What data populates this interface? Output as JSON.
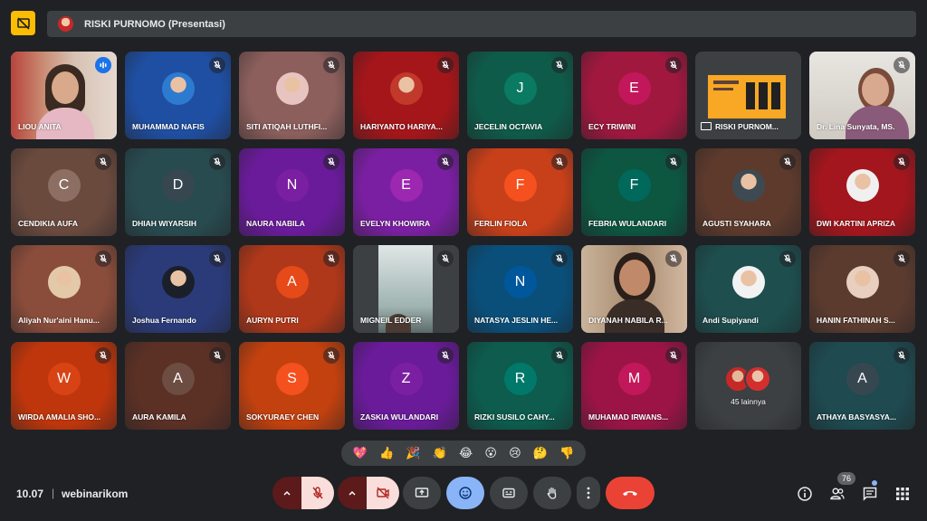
{
  "header": {
    "presenter_label": "RISKI PURNOMO (Presentasi)"
  },
  "tiles": [
    {
      "name": "LIOU ANITA",
      "kind": "video",
      "mic": "speaking",
      "bg": "#c8a58f"
    },
    {
      "name": "MUHAMMAD NAFIS",
      "kind": "photo",
      "mic": "muted",
      "bg": "#1f4fa3",
      "avatar": "#2d7bd1"
    },
    {
      "name": "SITI ATIQAH LUTHFI...",
      "kind": "photo",
      "mic": "muted",
      "bg": "#8c5f5c",
      "avatar": "#e8c4c0"
    },
    {
      "name": "HARIYANTO HARIYA...",
      "kind": "photo",
      "mic": "muted",
      "bg": "#a5161a",
      "avatar": "#c0392b"
    },
    {
      "name": "JECELIN OCTAVIA",
      "kind": "letter",
      "letter": "J",
      "mic": "muted",
      "bg": "#0f5b4a",
      "avatar": "#0b7a62"
    },
    {
      "name": "ECY TRIWINI",
      "kind": "letter",
      "letter": "E",
      "mic": "muted",
      "bg": "#a1183f",
      "avatar": "#c2185b"
    },
    {
      "name": "RISKI PURNOM...",
      "kind": "screen",
      "mic": "none",
      "bg": "#3c4043"
    },
    {
      "name": "Dr. Lina Sunyata, MS.",
      "kind": "video2",
      "mic": "muted",
      "bg": "#d9d6cf"
    },
    {
      "name": "CENDIKIA AUFA",
      "kind": "letter",
      "letter": "C",
      "mic": "muted",
      "bg": "#6b4a3e",
      "avatar": "#8d6e63"
    },
    {
      "name": "DHIAH WIYARSIH",
      "kind": "letter",
      "letter": "D",
      "mic": "muted",
      "bg": "#284b50",
      "avatar": "#37474f"
    },
    {
      "name": "NAURA NABILA",
      "kind": "letter",
      "letter": "N",
      "mic": "muted",
      "bg": "#6a1b9a",
      "avatar": "#7b1fa2"
    },
    {
      "name": "EVELYN KHOWIRA",
      "kind": "letter",
      "letter": "E",
      "mic": "muted",
      "bg": "#7b1fa2",
      "avatar": "#9c27b0"
    },
    {
      "name": "FERLIN FIOLA",
      "kind": "letter",
      "letter": "F",
      "mic": "muted",
      "bg": "#c8401a",
      "avatar": "#f4511e"
    },
    {
      "name": "FEBRIA WULANDARI",
      "kind": "letter",
      "letter": "F",
      "mic": "muted",
      "bg": "#0d5640",
      "avatar": "#00695c"
    },
    {
      "name": "AGUSTI SYAHARA",
      "kind": "photo",
      "mic": "muted",
      "bg": "#5d3a2c",
      "avatar": "#3e4a52"
    },
    {
      "name": "DWI KARTINI APRIZA",
      "kind": "photo",
      "mic": "muted",
      "bg": "#a3161d",
      "avatar": "#f0f0f0"
    },
    {
      "name": "Aliyah Nur'aini Hanu...",
      "kind": "photo",
      "mic": "muted",
      "bg": "#8b4d3b",
      "avatar": "#e3c9a8"
    },
    {
      "name": "Joshua Fernando",
      "kind": "photo",
      "mic": "muted",
      "bg": "#2b3b7a",
      "avatar": "#1b1f2a"
    },
    {
      "name": "AURYN PUTRI",
      "kind": "letter",
      "letter": "A",
      "mic": "muted",
      "bg": "#b0381a",
      "avatar": "#e64a19"
    },
    {
      "name": "MIGNEIL EDDER",
      "kind": "video3",
      "mic": "muted",
      "bg": "#4e5357"
    },
    {
      "name": "NATASYA JESLIN HE...",
      "kind": "letter",
      "letter": "N",
      "mic": "muted",
      "bg": "#0a4f7a",
      "avatar": "#01579b"
    },
    {
      "name": "DIYANAH NABILA R...",
      "kind": "video4",
      "mic": "muted",
      "bg": "#9a7257"
    },
    {
      "name": "Andi Supiyandi",
      "kind": "photo",
      "mic": "muted",
      "bg": "#1e4e4e",
      "avatar": "#f2f2f2"
    },
    {
      "name": "HANIN FATHINAH S...",
      "kind": "photo",
      "mic": "muted",
      "bg": "#5b3b2e",
      "avatar": "#e8cfc0"
    },
    {
      "name": "WIRDA AMALIA SHO...",
      "kind": "letter",
      "letter": "W",
      "mic": "muted",
      "bg": "#bf360c",
      "avatar": "#d84315"
    },
    {
      "name": "AURA KAMILA",
      "kind": "letter",
      "letter": "A",
      "mic": "muted",
      "bg": "#5b3025",
      "avatar": "#6d4c41"
    },
    {
      "name": "SOKYURAEY CHEN",
      "kind": "letter",
      "letter": "S",
      "mic": "muted",
      "bg": "#c2410f",
      "avatar": "#f4511e"
    },
    {
      "name": "ZASKIA WULANDARI",
      "kind": "letter",
      "letter": "Z",
      "mic": "muted",
      "bg": "#6a1b9a",
      "avatar": "#7b1fa2"
    },
    {
      "name": "RIZKI SUSILO CAHY...",
      "kind": "letter",
      "letter": "R",
      "mic": "muted",
      "bg": "#0d5c4e",
      "avatar": "#00796b"
    },
    {
      "name": "MUHAMAD IRWANS...",
      "kind": "letter",
      "letter": "M",
      "mic": "muted",
      "bg": "#9c1446",
      "avatar": "#c2185b"
    },
    {
      "name": "45 lainnya",
      "kind": "others",
      "mic": "none",
      "bg": "#3c4043"
    },
    {
      "name": "ATHAYA BASYASYA...",
      "kind": "letter",
      "letter": "A",
      "mic": "muted",
      "bg": "#1e4a50",
      "avatar": "#37474f"
    }
  ],
  "reactions": [
    "💖",
    "👍",
    "🎉",
    "👏",
    "😂",
    "😮",
    "😢",
    "🤔",
    "👎"
  ],
  "footer": {
    "time": "10.07",
    "separator": "|",
    "meeting_code": "webinarikom",
    "participant_count": "76"
  },
  "icons": {
    "present_now": "present-icon",
    "mic_off": "mic-off-icon",
    "camera_off": "camera-off-icon",
    "present": "present-screen-icon",
    "emoji": "emoji-icon",
    "captions": "captions-icon",
    "raise_hand": "raise-hand-icon",
    "more": "more-vert-icon",
    "hangup": "call-end-icon",
    "info": "info-icon",
    "people": "people-icon",
    "chat": "chat-icon",
    "activities": "apps-icon"
  },
  "colors": {
    "background": "#202124",
    "accent_blue": "#8ab4f8",
    "hangup_red": "#ea4335",
    "warning_yellow": "#fbbc04"
  }
}
